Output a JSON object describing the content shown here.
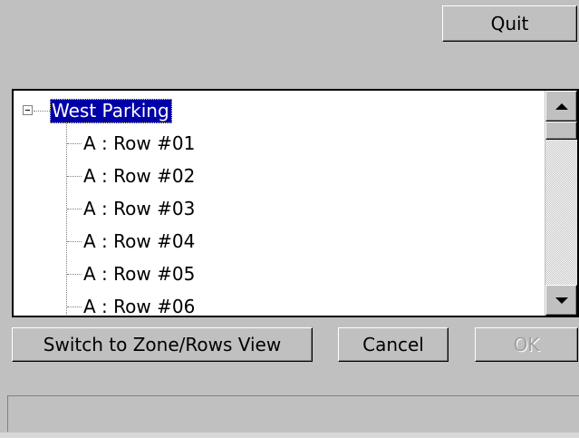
{
  "toolbar": {
    "quit_label": "Quit"
  },
  "tree": {
    "root": {
      "label": "West Parking",
      "expanded": true,
      "selected": true
    },
    "items": [
      {
        "label": "A : Row #01"
      },
      {
        "label": "A : Row #02"
      },
      {
        "label": "A : Row #03"
      },
      {
        "label": "A : Row #04"
      },
      {
        "label": "A : Row #05"
      },
      {
        "label": "A : Row #06"
      }
    ],
    "scroll_position": 0
  },
  "actions": {
    "switch_label": "Switch to Zone/Rows View",
    "cancel_label": "Cancel",
    "ok_label": "OK",
    "ok_enabled": false
  },
  "status": {
    "text": ""
  },
  "colors": {
    "window_bg": "#c0c0c0",
    "selection_bg": "#0000a8",
    "disabled_text": "#a0a0a0"
  },
  "icons": {
    "expander": "minus-box-icon",
    "scroll_up": "up-arrow-icon",
    "scroll_down": "down-arrow-icon"
  }
}
